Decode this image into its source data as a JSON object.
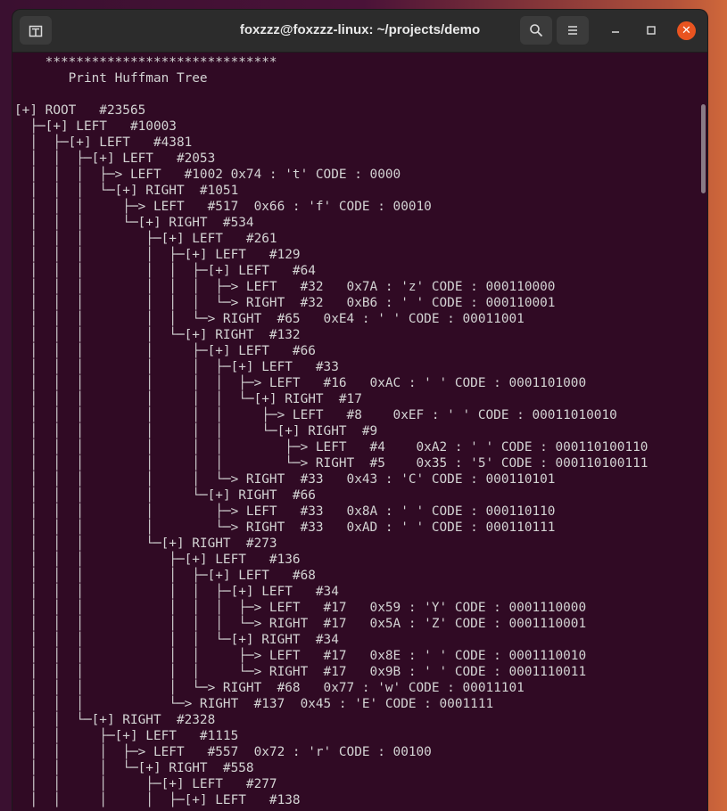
{
  "window": {
    "title": "foxzzz@foxzzz-linux: ~/projects/demo",
    "new_tab_icon": "new-tab-icon",
    "search_icon": "search-icon",
    "menu_icon": "hamburger-menu-icon",
    "minimize_glyph": "—",
    "maximize_glyph": "☐",
    "close_glyph": "✕",
    "accent_color": "#e95420"
  },
  "terminal": {
    "background": "#300a24",
    "foreground": "#d3d3d3",
    "lines": [
      "    ******************************",
      "       Print Huffman Tree",
      "",
      "[+] ROOT   #23565",
      "  ├─[+] LEFT   #10003",
      "  │  ├─[+] LEFT   #4381",
      "  │  │  ├─[+] LEFT   #2053",
      "  │  │  │  ├─> LEFT   #1002 0x74 : 't' CODE : 0000",
      "  │  │  │  └─[+] RIGHT  #1051",
      "  │  │  │     ├─> LEFT   #517  0x66 : 'f' CODE : 00010",
      "  │  │  │     └─[+] RIGHT  #534",
      "  │  │  │        ├─[+] LEFT   #261",
      "  │  │  │        │  ├─[+] LEFT   #129",
      "  │  │  │        │  │  ├─[+] LEFT   #64",
      "  │  │  │        │  │  │  ├─> LEFT   #32   0x7A : 'z' CODE : 000110000",
      "  │  │  │        │  │  │  └─> RIGHT  #32   0xB6 : ' ' CODE : 000110001",
      "  │  │  │        │  │  └─> RIGHT  #65   0xE4 : ' ' CODE : 00011001",
      "  │  │  │        │  └─[+] RIGHT  #132",
      "  │  │  │        │     ├─[+] LEFT   #66",
      "  │  │  │        │     │  ├─[+] LEFT   #33",
      "  │  │  │        │     │  │  ├─> LEFT   #16   0xAC : ' ' CODE : 0001101000",
      "  │  │  │        │     │  │  └─[+] RIGHT  #17",
      "  │  │  │        │     │  │     ├─> LEFT   #8    0xEF : ' ' CODE : 00011010010",
      "  │  │  │        │     │  │     └─[+] RIGHT  #9",
      "  │  │  │        │     │  │        ├─> LEFT   #4    0xA2 : ' ' CODE : 000110100110",
      "  │  │  │        │     │  │        └─> RIGHT  #5    0x35 : '5' CODE : 000110100111",
      "  │  │  │        │     │  └─> RIGHT  #33   0x43 : 'C' CODE : 000110101",
      "  │  │  │        │     └─[+] RIGHT  #66",
      "  │  │  │        │        ├─> LEFT   #33   0x8A : ' ' CODE : 000110110",
      "  │  │  │        │        └─> RIGHT  #33   0xAD : ' ' CODE : 000110111",
      "  │  │  │        └─[+] RIGHT  #273",
      "  │  │  │           ├─[+] LEFT   #136",
      "  │  │  │           │  ├─[+] LEFT   #68",
      "  │  │  │           │  │  ├─[+] LEFT   #34",
      "  │  │  │           │  │  │  ├─> LEFT   #17   0x59 : 'Y' CODE : 0001110000",
      "  │  │  │           │  │  │  └─> RIGHT  #17   0x5A : 'Z' CODE : 0001110001",
      "  │  │  │           │  │  └─[+] RIGHT  #34",
      "  │  │  │           │  │     ├─> LEFT   #17   0x8E : ' ' CODE : 0001110010",
      "  │  │  │           │  │     └─> RIGHT  #17   0x9B : ' ' CODE : 0001110011",
      "  │  │  │           │  └─> RIGHT  #68   0x77 : 'w' CODE : 00011101",
      "  │  │  │           └─> RIGHT  #137  0x45 : 'E' CODE : 0001111",
      "  │  │  └─[+] RIGHT  #2328",
      "  │  │     ├─[+] LEFT   #1115",
      "  │  │     │  ├─> LEFT   #557  0x72 : 'r' CODE : 00100",
      "  │  │     │  └─[+] RIGHT  #558",
      "  │  │     │     ├─[+] LEFT   #277",
      "  │  │     │     │  ├─[+] LEFT   #138"
    ]
  }
}
